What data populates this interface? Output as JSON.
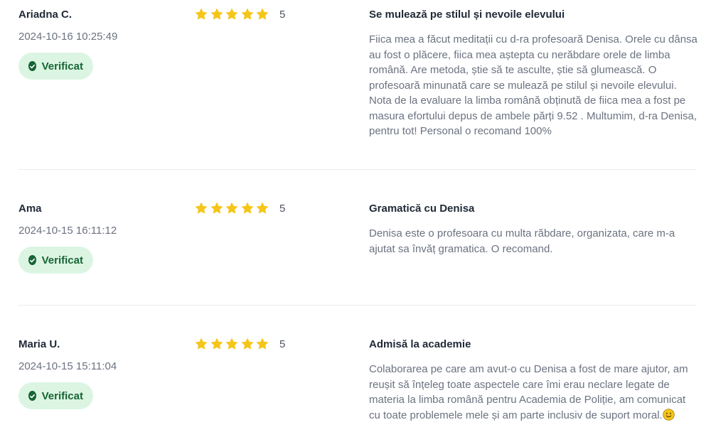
{
  "reviews": [
    {
      "author": "Ariadna C.",
      "date": "2024-10-16 10:25:49",
      "badge": "Verificat",
      "rating": 5,
      "rating_text": "5",
      "title": "Se mulează pe stilul și nevoile elevului",
      "body": "Fiica mea a făcut meditații cu d-ra profesoară Denisa. Orele cu dânsa au fost o plăcere, fiica mea aștepta cu nerăbdare orele de limba română. Are metoda, știe să te asculte, știe să glumească. O profesoară minunată care se mulează pe stilul și nevoile elevului. Nota de la evaluare la limba română obținută de fiica mea a fost pe masura efortului depus de ambele părți 9.52 . Multumim, d-ra Denisa, pentru tot! Personal o recomand 100%"
    },
    {
      "author": "Ama",
      "date": "2024-10-15 16:11:12",
      "badge": "Verificat",
      "rating": 5,
      "rating_text": "5",
      "title": "Gramatică cu Denisa",
      "body": "Denisa este o profesoara cu multa răbdare, organizata, care m-a ajutat sa învăț gramatica. O recomand."
    },
    {
      "author": "Maria U.",
      "date": "2024-10-15 15:11:04",
      "badge": "Verificat",
      "rating": 5,
      "rating_text": "5",
      "title": "Admisă la academie",
      "body": "Colaborarea pe care am avut-o cu Denisa a fost de mare ajutor, am reușit să înțeleg toate aspectele care îmi erau neclare legate de materia la limba română pentru Academia de Poliție, am comunicat cu toate problemele mele și am parte inclusiv de suport moral.",
      "body_emoji": "smiling-face-emoji"
    }
  ],
  "colors": {
    "star": "#f5c518",
    "badge_bg": "#dcf5e3",
    "badge_text": "#166534",
    "muted_text": "#6b7280",
    "divider": "#ececec"
  },
  "icons": {
    "star": "star-icon",
    "verified": "check-circle-icon"
  }
}
